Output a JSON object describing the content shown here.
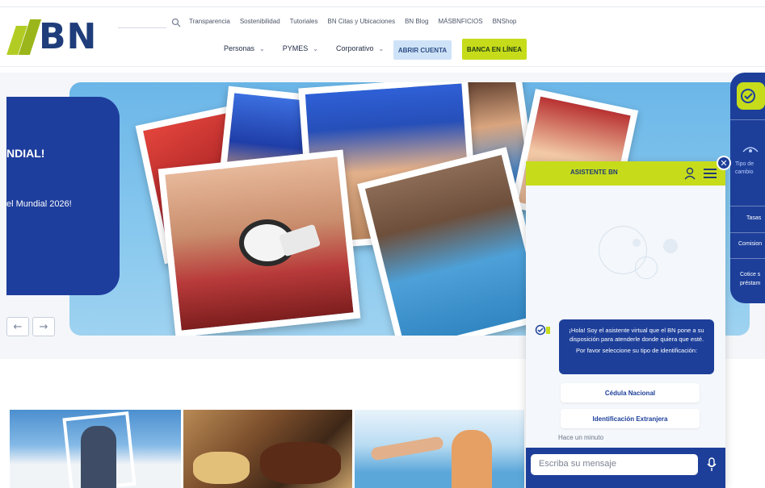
{
  "header": {
    "logo_text": "BN",
    "top_links": [
      "Transparencia",
      "Sostenibilidad",
      "Tutoriales",
      "BN Citas y Ubicaciones",
      "BN Blog",
      "MÁSBNFICIOS",
      "BNShop"
    ],
    "nav": [
      {
        "label": "Personas"
      },
      {
        "label": "PYMES"
      },
      {
        "label": "Corporativo"
      }
    ],
    "open_account": "ABRIR CUENTA",
    "online_banking": "BANCA EN LÍNEA",
    "chevron": "⌄"
  },
  "hero": {
    "title_fragment": "NDIAL!",
    "subtitle_fragment": "el Mundial 2026!",
    "prev_arrow": "←",
    "next_arrow": "→"
  },
  "rates_panel": {
    "label_1": "Tipo de",
    "label_2": "cambio",
    "item_1": "Tasas",
    "item_2": "Comision",
    "item_3a": "Cotice s",
    "item_3b": "préstam"
  },
  "chat": {
    "title": "ASISTENTE BN",
    "close": "✕",
    "greeting_1": "¡Hola! Soy el asistente virtual que el BN pone a su disposición para atenderle donde quiera que esté.",
    "greeting_2": "Por favor seleccione su tipo de identificación:",
    "option_1": "Cédula Nacional",
    "option_2": "Identificación Extranjera",
    "timestamp": "Hace un minuto",
    "placeholder": "Escriba su mensaje"
  },
  "colors": {
    "brand_blue": "#1d3f9a",
    "brand_green": "#c6dc1b",
    "logo_blue": "#1f3d7a"
  }
}
